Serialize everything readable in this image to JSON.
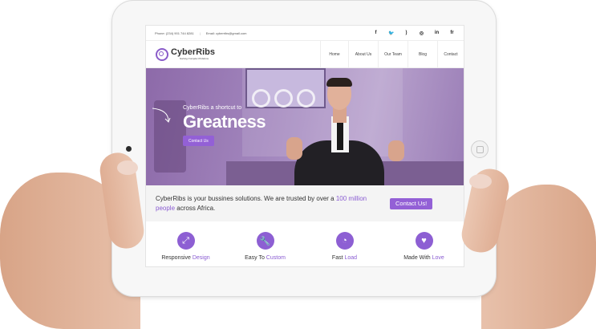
{
  "topbar": {
    "phone": "Phone: (234) 901 744 8281",
    "separator": "|",
    "email": "Email: cyberribs@gmail.com",
    "socials": [
      "f",
      "t",
      "rss",
      "d",
      "in",
      "fr"
    ]
  },
  "header": {
    "logo_title": "CyberRibs",
    "logo_tagline": "Solving Complex Problems",
    "nav": [
      "Home",
      "About Us",
      "Our Team",
      "Blog",
      "Contact"
    ]
  },
  "hero": {
    "subtitle": "CyberRibs a shortcut to",
    "title": "Greatness",
    "button": "Contact Us"
  },
  "cta": {
    "text_before": "CyberRibs is your bussines solutions. We are trusted by over a ",
    "highlight": "100 million people",
    "text_after": " across Africa.",
    "button": "Contact Us!"
  },
  "features": [
    {
      "icon": "expand-icon",
      "label": "Responsive ",
      "highlight": "Design"
    },
    {
      "icon": "wrench-icon",
      "label": "Easy To ",
      "highlight": "Custom"
    },
    {
      "icon": "speedometer-icon",
      "label": "Fast ",
      "highlight": "Load"
    },
    {
      "icon": "heart-icon",
      "label": "Made With ",
      "highlight": "Love"
    }
  ],
  "colors": {
    "accent": "#9360d6",
    "hero": "#a58ac0"
  }
}
